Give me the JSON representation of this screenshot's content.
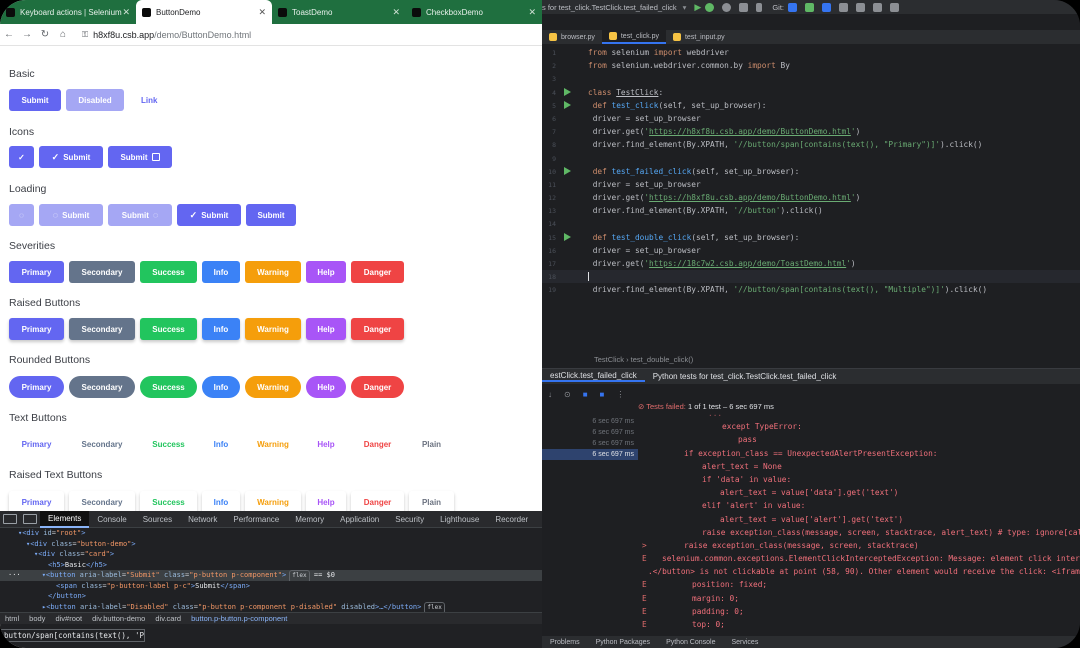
{
  "browser": {
    "tabs": [
      "Keyboard actions | Selenium",
      "ButtonDemo",
      "ToastDemo",
      "CheckboxDemo"
    ],
    "url_host": "h8xf8u.csb.app",
    "url_path": "/demo/ButtonDemo.html",
    "sections": {
      "basic": {
        "title": "Basic",
        "submit": "Submit",
        "disabled": "Disabled",
        "link": "Link"
      },
      "icons": {
        "title": "Icons",
        "submit1": "Submit",
        "submit2": "Submit"
      },
      "loading": {
        "title": "Loading",
        "submit1": "Submit",
        "submit2": "Submit",
        "submit3": "Submit",
        "submit4": "Submit"
      },
      "severities": {
        "title": "Severities"
      },
      "raised": {
        "title": "Raised Buttons"
      },
      "rounded": {
        "title": "Rounded Buttons"
      },
      "text": {
        "title": "Text Buttons"
      },
      "raised_text": {
        "title": "Raised Text Buttons"
      }
    },
    "severity_labels": [
      "Primary",
      "Secondary",
      "Success",
      "Info",
      "Warning",
      "Help",
      "Danger"
    ],
    "plain_label": "Plain",
    "colors": {
      "primary": "#6366f1",
      "secondary": "#64748b",
      "success": "#22c55e",
      "info": "#3b82f6",
      "warning": "#f59e0b",
      "help": "#a855f7",
      "danger": "#ef4444"
    }
  },
  "devtools": {
    "tabs": [
      "Elements",
      "Console",
      "Sources",
      "Network",
      "Performance",
      "Memory",
      "Application",
      "Security",
      "Lighthouse",
      "Recorder"
    ],
    "breadcrumbs": [
      "html",
      "body",
      "div#root",
      "div.button-demo",
      "div.card",
      "button.p-button.p-component"
    ],
    "xpath": "button/span[contains(text(), 'Primary')]"
  },
  "ide": {
    "title": "s for test_click.TestClick.test_failed_click",
    "vcs": "Git:",
    "tabs": [
      "browser.py",
      "test_click.py",
      "test_input.py"
    ],
    "breadcrumb": "TestClick  ›  test_double_click()",
    "run_tabs": [
      "estClick.test_failed_click",
      "Python tests for test_click.TestClick.test_failed_click"
    ],
    "tests_failed": "Tests failed:",
    "tests_summary": "1 of 1 test – 6 sec 697 ms",
    "tree_times": [
      "6 sec 697 ms",
      "6 sec 697 ms",
      "6 sec 697 ms",
      "6 sec 697 ms"
    ],
    "status_items": [
      "Problems",
      "Python Packages",
      "Python Console",
      "Services"
    ]
  }
}
